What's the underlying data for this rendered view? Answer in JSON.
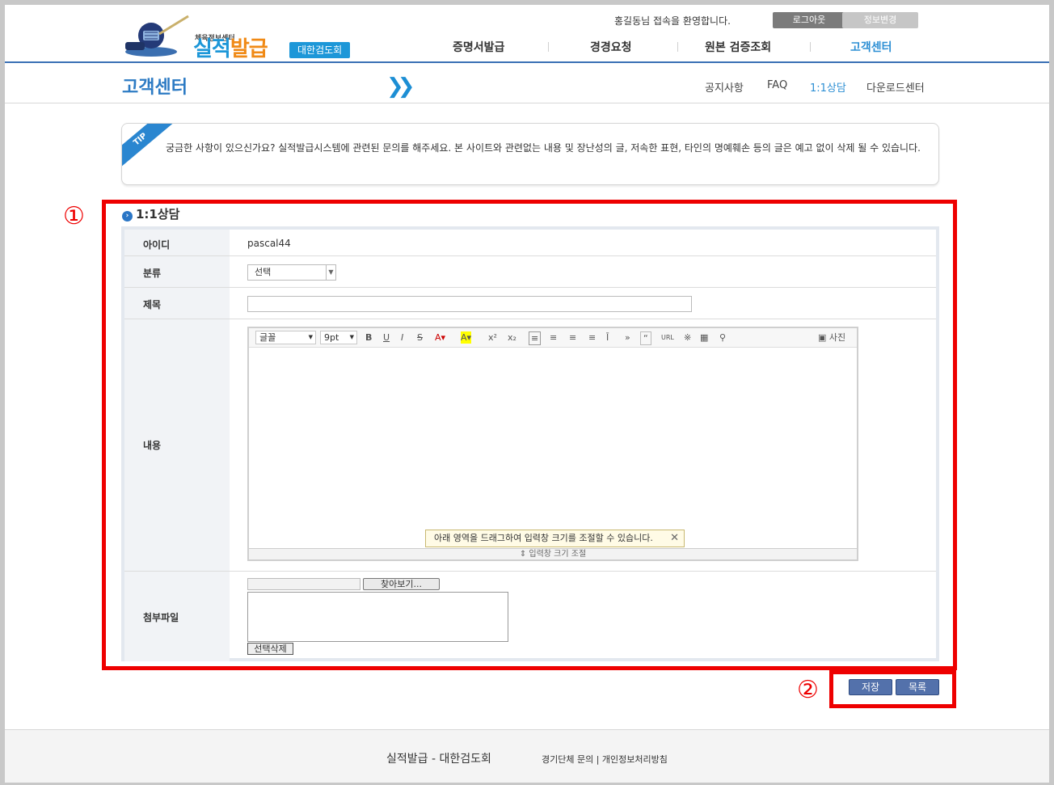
{
  "header": {
    "logo_small": "체육정보센터",
    "logo_main_a": "실적",
    "logo_main_b": "발급",
    "logo_badge": "대한검도회",
    "welcome": "홍길동님 접속을 환영합니다.",
    "logout_label": "로그아웃",
    "info_change_label": "정보변경",
    "gnb": [
      "증명서발급",
      "경경요청",
      "원본 검증조회",
      "고객센터"
    ]
  },
  "subheader": {
    "title": "고객센터",
    "nav": [
      "공지사항",
      "FAQ",
      "1:1상담",
      "다운로드센터"
    ]
  },
  "tip": {
    "badge": "TIP",
    "text": "궁금한 사항이 있으신가요? 실적발급시스템에 관련된 문의를 해주세요. 본 사이트와 관련없는 내용 및 장난성의 글, 저속한 표현, 타인의 명예훼손 등의 글은 예고 없이 삭제 될 수 있습니다."
  },
  "markers": {
    "one": "①",
    "two": "②"
  },
  "section": {
    "title": "1:1상담",
    "fields": {
      "id_label": "아이디",
      "id_value": "pascal44",
      "category_label": "분류",
      "category_value": "선택",
      "subject_label": "제목",
      "subject_value": "",
      "content_label": "내용",
      "attach_label": "첨부파일"
    },
    "editor": {
      "font": "글꼴",
      "size": "9pt",
      "photo": "사진",
      "tooltip": "아래 영역을 드래그하여 입력창 크기를 조절할 수 있습니다.",
      "resize": "입력창 크기 조절"
    },
    "attach": {
      "browse": "찾아보기...",
      "delete": "선택삭제"
    }
  },
  "actions": {
    "save": "저장",
    "list": "목록"
  },
  "footer": {
    "brand": "실적발급 - 대한검도회",
    "links": "경기단체 문의 | 개인정보처리방침"
  }
}
